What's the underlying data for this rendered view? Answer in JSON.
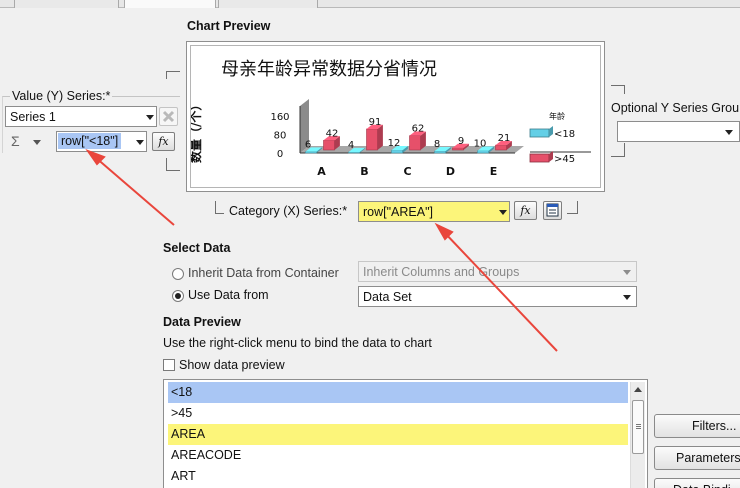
{
  "chart_preview": {
    "section_title": "Chart Preview",
    "chart_title": "母亲年龄异常数据分省情况",
    "y_axis_label": "数量（/个）",
    "legend_title": "年龄",
    "chart_data": {
      "type": "bar",
      "title": "母亲年龄异常数据分省情况",
      "xlabel": "",
      "ylabel": "数量（/个）",
      "categories": [
        "A",
        "B",
        "C",
        "D",
        "E"
      ],
      "ylim": [
        0,
        160
      ],
      "yticks": [
        0,
        80,
        160
      ],
      "series": [
        {
          "name": "<18",
          "values": [
            6,
            4,
            12,
            8,
            10
          ],
          "color": "#63cfe6"
        },
        {
          "name": ">45",
          "values": [
            42,
            91,
            62,
            9,
            21
          ],
          "color": "#e6506a"
        }
      ],
      "legend_position": "right",
      "grid": false
    }
  },
  "value_series": {
    "label": "Value (Y) Series:*",
    "selected": "Series 1",
    "sigma": "Σ",
    "expression": "row[\"<18\"]",
    "fx": "fx"
  },
  "optional_series": {
    "label": "Optional Y Series Grou",
    "value": ""
  },
  "category_series": {
    "label": "Category (X) Series:*",
    "expression": "row[\"AREA\"]",
    "fx": "fx"
  },
  "select_data": {
    "title": "Select Data",
    "option_inherit": "Inherit Data from Container",
    "inherit_value": "Inherit Columns and Groups",
    "option_use": "Use Data from",
    "use_value": "Data Set"
  },
  "data_preview": {
    "title": "Data Preview",
    "hint": "Use the right-click menu to bind the data to chart",
    "show_checkbox": "Show data preview",
    "columns": [
      "<18",
      ">45",
      "AREA",
      "AREACODE",
      "ART"
    ]
  },
  "buttons": {
    "filters": "Filters...",
    "parameters": "Parameters",
    "data_binding": "Data Bindi"
  },
  "colors": {
    "arrow": "#e9463c",
    "highlight_yellow": "#fcf57a",
    "highlight_blue": "#a9c6f4",
    "bar_cyan": "#63cfe6",
    "bar_red": "#e6506a"
  }
}
